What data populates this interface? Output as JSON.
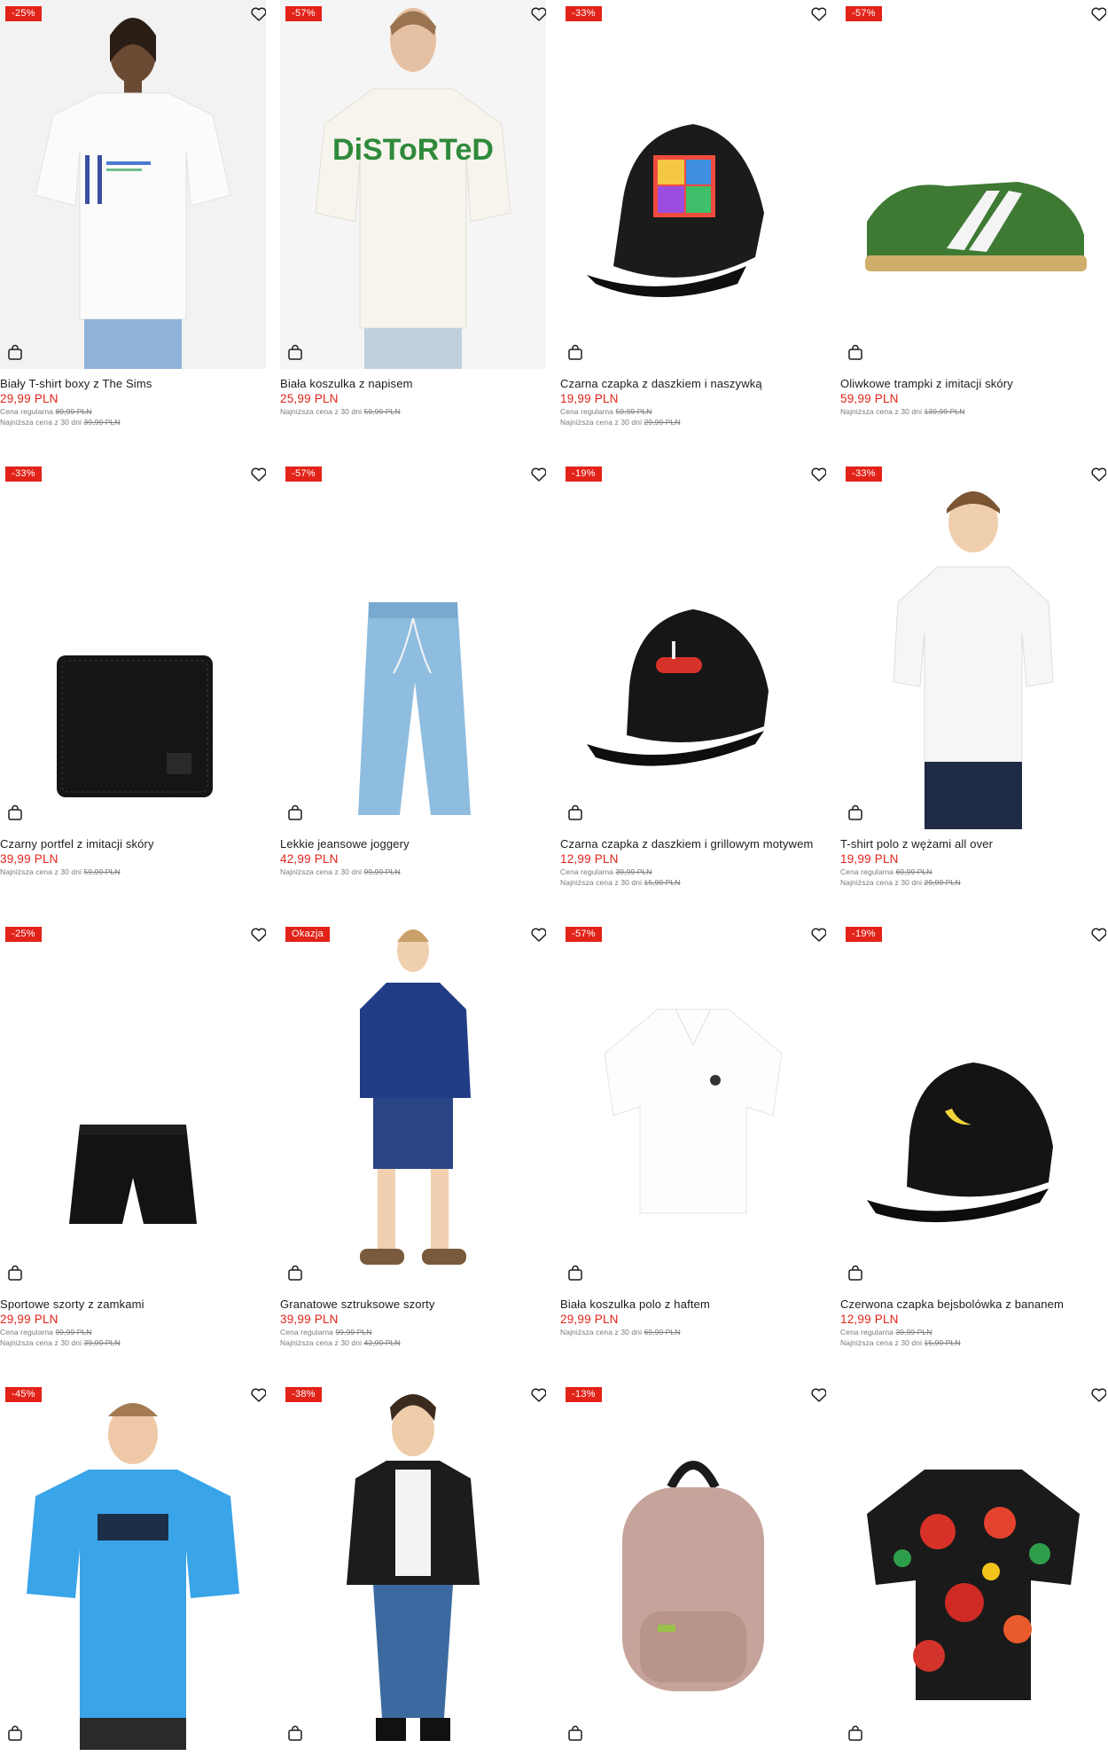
{
  "currency_note": "PLN",
  "products": [
    {
      "badge": "-25%",
      "name": "Biały T-shirt boxy z The Sims",
      "price": "29,99 PLN",
      "regular_label": "Cena regularna",
      "regular_value": "89,99 PLN",
      "lowest_label": "Najniższa cena z 30 dni",
      "lowest_value": "39,99 PLN",
      "image": "white-tshirt-model"
    },
    {
      "badge": "-57%",
      "name": "Biała koszulka z napisem",
      "price": "25,99 PLN",
      "regular_label": "",
      "regular_value": "",
      "lowest_label": "Najniższa cena z 30 dni",
      "lowest_value": "59,99 PLN",
      "image": "white-graphic-tshirt-model"
    },
    {
      "badge": "-33%",
      "name": "Czarna czapka z daszkiem i naszywką",
      "price": "19,99 PLN",
      "regular_label": "Cena regularna",
      "regular_value": "59,99 PLN",
      "lowest_label": "Najniższa cena z 30 dni",
      "lowest_value": "29,99 PLN",
      "image": "black-cap-patch"
    },
    {
      "badge": "-57%",
      "name": "Oliwkowe trampki z imitacji skóry",
      "price": "59,99 PLN",
      "regular_label": "",
      "regular_value": "",
      "lowest_label": "Najniższa cena z 30 dni",
      "lowest_value": "139,99 PLN",
      "image": "olive-sneaker"
    },
    {
      "badge": "-33%",
      "name": "Czarny portfel z imitacji skóry",
      "price": "39,99 PLN",
      "regular_label": "",
      "regular_value": "",
      "lowest_label": "Najniższa cena z 30 dni",
      "lowest_value": "59,99 PLN",
      "image": "black-wallet"
    },
    {
      "badge": "-57%",
      "name": "Lekkie jeansowe joggery",
      "price": "42,99 PLN",
      "regular_label": "",
      "regular_value": "",
      "lowest_label": "Najniższa cena z 30 dni",
      "lowest_value": "99,99 PLN",
      "image": "denim-joggers"
    },
    {
      "badge": "-19%",
      "name": "Czarna czapka z daszkiem i grillowym motywem",
      "price": "12,99 PLN",
      "regular_label": "Cena regularna",
      "regular_value": "39,99 PLN",
      "lowest_label": "Najniższa cena z 30 dni",
      "lowest_value": "15,99 PLN",
      "image": "black-cap-sausage"
    },
    {
      "badge": "-33%",
      "name": "T-shirt polo z wężami all over",
      "price": "19,99 PLN",
      "regular_label": "Cena regularna",
      "regular_value": "69,99 PLN",
      "lowest_label": "Najniższa cena z 30 dni",
      "lowest_value": "29,99 PLN",
      "image": "white-polo-model"
    },
    {
      "badge": "-25%",
      "name": "Sportowe szorty z zamkami",
      "price": "29,99 PLN",
      "regular_label": "Cena regularna",
      "regular_value": "99,99 PLN",
      "lowest_label": "Najniższa cena z 30 dni",
      "lowest_value": "39,99 PLN",
      "image": "black-shorts"
    },
    {
      "badge": "Okazja",
      "name": "Granatowe sztruksowe szorty",
      "price": "39,99 PLN",
      "regular_label": "Cena regularna",
      "regular_value": "99,99 PLN",
      "lowest_label": "Najniższa cena z 30 dni",
      "lowest_value": "42,99 PLN",
      "image": "navy-set-model"
    },
    {
      "badge": "-57%",
      "name": "Biała koszulka polo z haftem",
      "price": "29,99 PLN",
      "regular_label": "",
      "regular_value": "",
      "lowest_label": "Najniższa cena z 30 dni",
      "lowest_value": "69,99 PLN",
      "image": "white-polo"
    },
    {
      "badge": "-19%",
      "name": "Czerwona czapka bejsbolówka z bananem",
      "price": "12,99 PLN",
      "regular_label": "Cena regularna",
      "regular_value": "39,99 PLN",
      "lowest_label": "Najniższa cena z 30 dni",
      "lowest_value": "15,99 PLN",
      "image": "black-cap-banana"
    },
    {
      "badge": "-45%",
      "name": "",
      "price": "",
      "regular_label": "",
      "regular_value": "",
      "lowest_label": "",
      "lowest_value": "",
      "image": "blue-jersey-model"
    },
    {
      "badge": "-38%",
      "name": "",
      "price": "",
      "regular_label": "",
      "regular_value": "",
      "lowest_label": "",
      "lowest_value": "",
      "image": "black-jacket-model"
    },
    {
      "badge": "-13%",
      "name": "",
      "price": "",
      "regular_label": "",
      "regular_value": "",
      "lowest_label": "",
      "lowest_value": "",
      "image": "pink-backpack"
    },
    {
      "badge": "",
      "name": "",
      "price": "",
      "regular_label": "",
      "regular_value": "",
      "lowest_label": "",
      "lowest_value": "",
      "image": "floral-shirt"
    }
  ],
  "icons": {
    "favorite": "heart-outline-icon",
    "cart": "shopping-bag-icon"
  },
  "colors": {
    "sale": "#e2231a",
    "text": "#1c1c1c",
    "muted": "#7a7a7a"
  }
}
